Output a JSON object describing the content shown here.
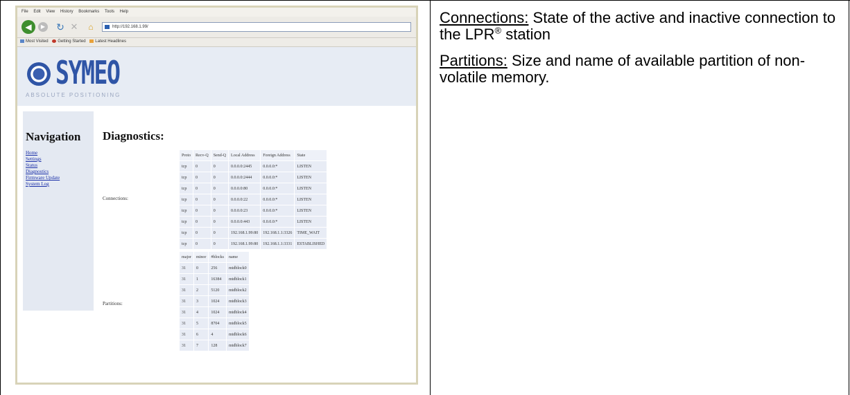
{
  "browser": {
    "menu": [
      "File",
      "Edit",
      "View",
      "History",
      "Bookmarks",
      "Tools",
      "Help"
    ],
    "url": "http://192.168.1.99/",
    "bookmarks": [
      "Most Visited",
      "Getting Started",
      "Latest Headlines"
    ]
  },
  "logo": {
    "name": "SYMEO",
    "tagline": "ABSOLUTE POSITIONING"
  },
  "navigation": {
    "title": "Navigation",
    "links": [
      "Home",
      "Settings",
      "Status",
      "Diagnostics",
      "Firmware Update",
      "System Log"
    ]
  },
  "page_title": "Diagnostics:",
  "connections": {
    "label": "Connections:",
    "headers": [
      "Proto",
      "Recv-Q",
      "Send-Q",
      "Local Address",
      "Foreign Address",
      "State"
    ],
    "rows": [
      [
        "tcp",
        "0",
        "0",
        "0.0.0.0:2445",
        "0.0.0.0:*",
        "LISTEN"
      ],
      [
        "tcp",
        "0",
        "0",
        "0.0.0.0:2444",
        "0.0.0.0:*",
        "LISTEN"
      ],
      [
        "tcp",
        "0",
        "0",
        "0.0.0.0:80",
        "0.0.0.0:*",
        "LISTEN"
      ],
      [
        "tcp",
        "0",
        "0",
        "0.0.0.0:22",
        "0.0.0.0:*",
        "LISTEN"
      ],
      [
        "tcp",
        "0",
        "0",
        "0.0.0.0:23",
        "0.0.0.0:*",
        "LISTEN"
      ],
      [
        "tcp",
        "0",
        "0",
        "0.0.0.0:443",
        "0.0.0.0:*",
        "LISTEN"
      ],
      [
        "tcp",
        "0",
        "0",
        "192.168.1.99:80",
        "192.168.1.1:3326",
        "TIME_WAIT"
      ],
      [
        "tcp",
        "0",
        "0",
        "192.168.1.99:80",
        "192.168.1.1:3331",
        "ESTABLISHED"
      ]
    ]
  },
  "partitions": {
    "label": "Partitions:",
    "headers": [
      "major",
      "minor",
      "#blocks",
      "name"
    ],
    "rows": [
      [
        "31",
        "0",
        "256",
        "mtdblock0"
      ],
      [
        "31",
        "1",
        "16384",
        "mtdblock1"
      ],
      [
        "31",
        "2",
        "5120",
        "mtdblock2"
      ],
      [
        "31",
        "3",
        "1024",
        "mtdblock3"
      ],
      [
        "31",
        "4",
        "1024",
        "mtdblock4"
      ],
      [
        "31",
        "5",
        "8704",
        "mtdblock5"
      ],
      [
        "31",
        "6",
        "4",
        "mtdblock6"
      ],
      [
        "31",
        "7",
        "128",
        "mtdblock7"
      ]
    ]
  },
  "description": {
    "connections_term": "Connections:",
    "connections_text_before": " State of the active and inactive connection to the LPR",
    "registered_mark": "®",
    "connections_text_after": " station",
    "partitions_term": "Partitions:",
    "partitions_text": " Size and name of available partition of non-volatile memory."
  },
  "colors": {
    "logo_blue": "#2f55a6",
    "banner_bg": "#e7ecf4",
    "table_cell_bg": "#e8ecf5",
    "link_blue": "#1a2fa8"
  }
}
